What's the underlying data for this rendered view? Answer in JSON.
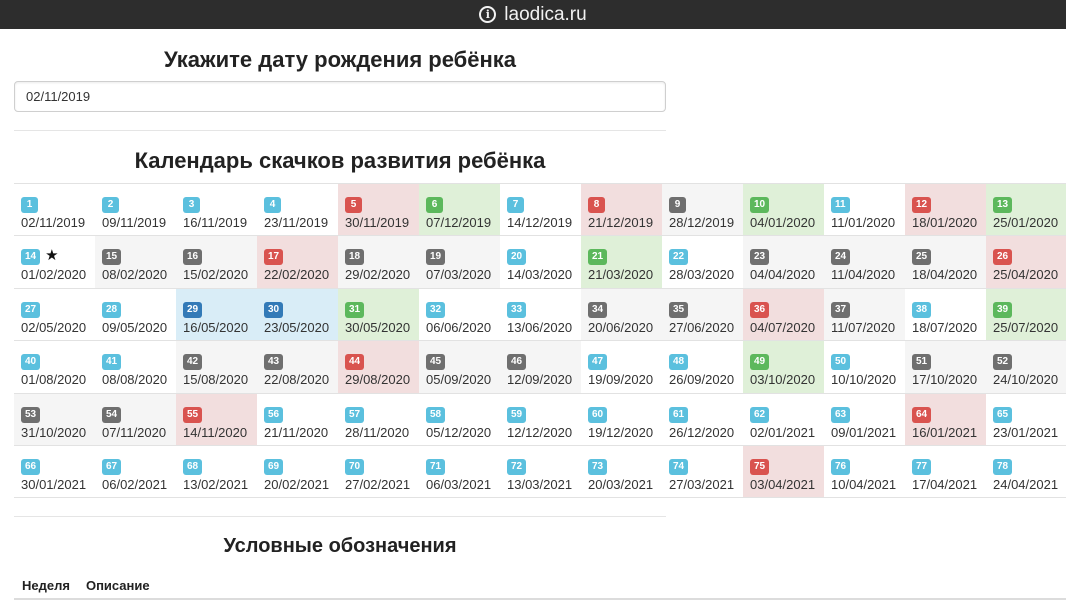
{
  "browser": {
    "url": "laodica.ru",
    "icon": "info-icon"
  },
  "birth_section": {
    "title": "Укажите дату рождения ребёнка",
    "input_value": "02/11/2019"
  },
  "calendar_section": {
    "title": "Календарь скачков развития ребёнка"
  },
  "legend_section": {
    "title": "Условные обозначения",
    "col_week": "Неделя",
    "col_description": "Описание"
  },
  "colors": {
    "info": "#5bc0de",
    "danger": "#d9534f",
    "success": "#5cb85c",
    "default": "#6f6f6f",
    "primary": "#337ab7",
    "bg_red": "#f2dede",
    "bg_green": "#dff0d8",
    "bg_gray": "#f5f5f5",
    "bg_blue": "#d9edf7"
  },
  "weeks": [
    {
      "n": "1",
      "date": "02/11/2019",
      "badge": "info",
      "bg": "white"
    },
    {
      "n": "2",
      "date": "09/11/2019",
      "badge": "info",
      "bg": "white"
    },
    {
      "n": "3",
      "date": "16/11/2019",
      "badge": "info",
      "bg": "white"
    },
    {
      "n": "4",
      "date": "23/11/2019",
      "badge": "info",
      "bg": "white"
    },
    {
      "n": "5",
      "date": "30/11/2019",
      "badge": "danger",
      "bg": "red"
    },
    {
      "n": "6",
      "date": "07/12/2019",
      "badge": "success",
      "bg": "green"
    },
    {
      "n": "7",
      "date": "14/12/2019",
      "badge": "info",
      "bg": "white"
    },
    {
      "n": "8",
      "date": "21/12/2019",
      "badge": "danger",
      "bg": "red"
    },
    {
      "n": "9",
      "date": "28/12/2019",
      "badge": "default",
      "bg": "gray"
    },
    {
      "n": "10",
      "date": "04/01/2020",
      "badge": "success",
      "bg": "green"
    },
    {
      "n": "11",
      "date": "11/01/2020",
      "badge": "info",
      "bg": "white"
    },
    {
      "n": "12",
      "date": "18/01/2020",
      "badge": "danger",
      "bg": "red"
    },
    {
      "n": "13",
      "date": "25/01/2020",
      "badge": "success",
      "bg": "green"
    },
    {
      "n": "14",
      "date": "01/02/2020",
      "badge": "info",
      "bg": "white",
      "star": "★"
    },
    {
      "n": "15",
      "date": "08/02/2020",
      "badge": "default",
      "bg": "gray"
    },
    {
      "n": "16",
      "date": "15/02/2020",
      "badge": "default",
      "bg": "gray"
    },
    {
      "n": "17",
      "date": "22/02/2020",
      "badge": "danger",
      "bg": "red"
    },
    {
      "n": "18",
      "date": "29/02/2020",
      "badge": "default",
      "bg": "gray"
    },
    {
      "n": "19",
      "date": "07/03/2020",
      "badge": "default",
      "bg": "gray"
    },
    {
      "n": "20",
      "date": "14/03/2020",
      "badge": "info",
      "bg": "white"
    },
    {
      "n": "21",
      "date": "21/03/2020",
      "badge": "success",
      "bg": "green"
    },
    {
      "n": "22",
      "date": "28/03/2020",
      "badge": "info",
      "bg": "white"
    },
    {
      "n": "23",
      "date": "04/04/2020",
      "badge": "default",
      "bg": "gray"
    },
    {
      "n": "24",
      "date": "11/04/2020",
      "badge": "default",
      "bg": "gray"
    },
    {
      "n": "25",
      "date": "18/04/2020",
      "badge": "default",
      "bg": "gray"
    },
    {
      "n": "26",
      "date": "25/04/2020",
      "badge": "danger",
      "bg": "red"
    },
    {
      "n": "27",
      "date": "02/05/2020",
      "badge": "info",
      "bg": "white"
    },
    {
      "n": "28",
      "date": "09/05/2020",
      "badge": "info",
      "bg": "white"
    },
    {
      "n": "29",
      "date": "16/05/2020",
      "badge": "primary",
      "bg": "blue"
    },
    {
      "n": "30",
      "date": "23/05/2020",
      "badge": "primary",
      "bg": "blue"
    },
    {
      "n": "31",
      "date": "30/05/2020",
      "badge": "success",
      "bg": "green"
    },
    {
      "n": "32",
      "date": "06/06/2020",
      "badge": "info",
      "bg": "white"
    },
    {
      "n": "33",
      "date": "13/06/2020",
      "badge": "info",
      "bg": "white"
    },
    {
      "n": "34",
      "date": "20/06/2020",
      "badge": "default",
      "bg": "gray"
    },
    {
      "n": "35",
      "date": "27/06/2020",
      "badge": "default",
      "bg": "gray"
    },
    {
      "n": "36",
      "date": "04/07/2020",
      "badge": "danger",
      "bg": "red"
    },
    {
      "n": "37",
      "date": "11/07/2020",
      "badge": "default",
      "bg": "gray"
    },
    {
      "n": "38",
      "date": "18/07/2020",
      "badge": "info",
      "bg": "white"
    },
    {
      "n": "39",
      "date": "25/07/2020",
      "badge": "success",
      "bg": "green"
    },
    {
      "n": "40",
      "date": "01/08/2020",
      "badge": "info",
      "bg": "white"
    },
    {
      "n": "41",
      "date": "08/08/2020",
      "badge": "info",
      "bg": "white"
    },
    {
      "n": "42",
      "date": "15/08/2020",
      "badge": "default",
      "bg": "gray"
    },
    {
      "n": "43",
      "date": "22/08/2020",
      "badge": "default",
      "bg": "gray"
    },
    {
      "n": "44",
      "date": "29/08/2020",
      "badge": "danger",
      "bg": "red"
    },
    {
      "n": "45",
      "date": "05/09/2020",
      "badge": "default",
      "bg": "gray"
    },
    {
      "n": "46",
      "date": "12/09/2020",
      "badge": "default",
      "bg": "gray"
    },
    {
      "n": "47",
      "date": "19/09/2020",
      "badge": "info",
      "bg": "white"
    },
    {
      "n": "48",
      "date": "26/09/2020",
      "badge": "info",
      "bg": "white"
    },
    {
      "n": "49",
      "date": "03/10/2020",
      "badge": "success",
      "bg": "green"
    },
    {
      "n": "50",
      "date": "10/10/2020",
      "badge": "info",
      "bg": "white"
    },
    {
      "n": "51",
      "date": "17/10/2020",
      "badge": "default",
      "bg": "gray"
    },
    {
      "n": "52",
      "date": "24/10/2020",
      "badge": "default",
      "bg": "gray"
    },
    {
      "n": "53",
      "date": "31/10/2020",
      "badge": "default",
      "bg": "gray"
    },
    {
      "n": "54",
      "date": "07/11/2020",
      "badge": "default",
      "bg": "gray"
    },
    {
      "n": "55",
      "date": "14/11/2020",
      "badge": "danger",
      "bg": "red"
    },
    {
      "n": "56",
      "date": "21/11/2020",
      "badge": "info",
      "bg": "white"
    },
    {
      "n": "57",
      "date": "28/11/2020",
      "badge": "info",
      "bg": "white"
    },
    {
      "n": "58",
      "date": "05/12/2020",
      "badge": "info",
      "bg": "white"
    },
    {
      "n": "59",
      "date": "12/12/2020",
      "badge": "info",
      "bg": "white"
    },
    {
      "n": "60",
      "date": "19/12/2020",
      "badge": "info",
      "bg": "white"
    },
    {
      "n": "61",
      "date": "26/12/2020",
      "badge": "info",
      "bg": "white"
    },
    {
      "n": "62",
      "date": "02/01/2021",
      "badge": "info",
      "bg": "white"
    },
    {
      "n": "63",
      "date": "09/01/2021",
      "badge": "info",
      "bg": "white"
    },
    {
      "n": "64",
      "date": "16/01/2021",
      "badge": "danger",
      "bg": "red"
    },
    {
      "n": "65",
      "date": "23/01/2021",
      "badge": "info",
      "bg": "white"
    },
    {
      "n": "66",
      "date": "30/01/2021",
      "badge": "info",
      "bg": "white"
    },
    {
      "n": "67",
      "date": "06/02/2021",
      "badge": "info",
      "bg": "white"
    },
    {
      "n": "68",
      "date": "13/02/2021",
      "badge": "info",
      "bg": "white"
    },
    {
      "n": "69",
      "date": "20/02/2021",
      "badge": "info",
      "bg": "white"
    },
    {
      "n": "70",
      "date": "27/02/2021",
      "badge": "info",
      "bg": "white"
    },
    {
      "n": "71",
      "date": "06/03/2021",
      "badge": "info",
      "bg": "white"
    },
    {
      "n": "72",
      "date": "13/03/2021",
      "badge": "info",
      "bg": "white"
    },
    {
      "n": "73",
      "date": "20/03/2021",
      "badge": "info",
      "bg": "white"
    },
    {
      "n": "74",
      "date": "27/03/2021",
      "badge": "info",
      "bg": "white"
    },
    {
      "n": "75",
      "date": "03/04/2021",
      "badge": "danger",
      "bg": "red"
    },
    {
      "n": "76",
      "date": "10/04/2021",
      "badge": "info",
      "bg": "white"
    },
    {
      "n": "77",
      "date": "17/04/2021",
      "badge": "info",
      "bg": "white"
    },
    {
      "n": "78",
      "date": "24/04/2021",
      "badge": "info",
      "bg": "white"
    }
  ]
}
